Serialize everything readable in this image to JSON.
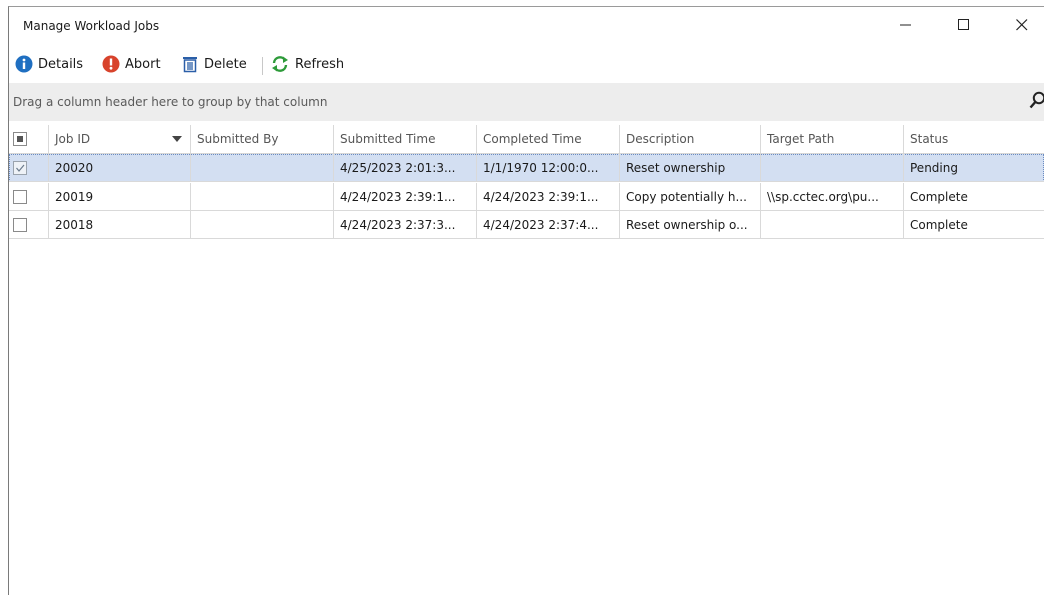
{
  "window": {
    "title": "Manage Workload Jobs"
  },
  "toolbar": {
    "details": "Details",
    "abort": "Abort",
    "delete": "Delete",
    "refresh": "Refresh"
  },
  "groupbar": {
    "text": "Drag a column header here to group by that column"
  },
  "columns": [
    "Job ID",
    "Submitted By",
    "Submitted Time",
    "Completed Time",
    "Description",
    "Target Path",
    "Status"
  ],
  "rows": [
    {
      "checked": true,
      "job_id": "20020",
      "submitted_by": "",
      "submitted_time": "4/25/2023 2:01:3...",
      "completed_time": "1/1/1970 12:00:0...",
      "description": "Reset ownership",
      "target_path": "",
      "status": "Pending"
    },
    {
      "checked": false,
      "job_id": "20019",
      "submitted_by": "",
      "submitted_time": "4/24/2023 2:39:1...",
      "completed_time": "4/24/2023 2:39:1...",
      "description": "Copy potentially h...",
      "target_path": "\\\\sp.cctec.org\\pu...",
      "status": "Complete"
    },
    {
      "checked": false,
      "job_id": "20018",
      "submitted_by": "",
      "submitted_time": "4/24/2023 2:37:3...",
      "completed_time": "4/24/2023 2:37:4...",
      "description": "Reset ownership o...",
      "target_path": "",
      "status": "Complete"
    }
  ],
  "colors": {
    "selected_row": "#d3dff2",
    "info_icon": "#1f6fc1",
    "abort_icon": "#d8432c",
    "refresh_icon": "#2e9b3a",
    "delete_icon": "#2b5fa8"
  },
  "icons": [
    "info-icon",
    "abort-icon",
    "delete-icon",
    "refresh-icon",
    "search-icon",
    "minimize-icon",
    "maximize-icon",
    "close-icon",
    "sort-down-icon"
  ]
}
